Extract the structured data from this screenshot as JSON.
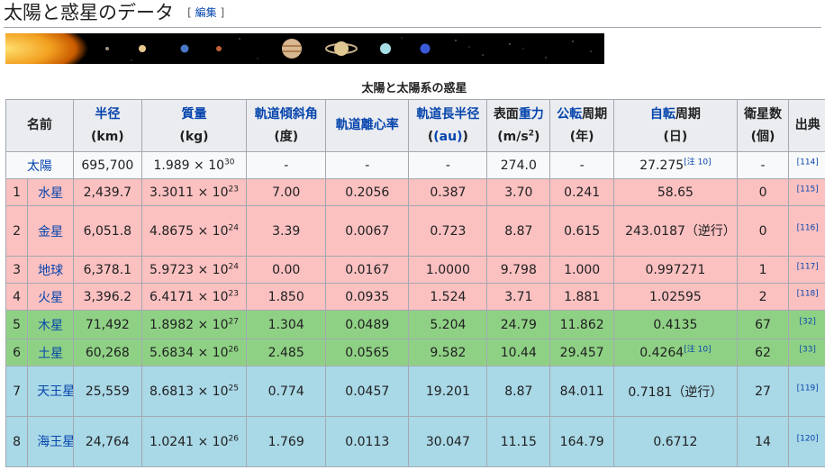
{
  "heading": {
    "title": "太陽と惑星のデータ",
    "edit_open": "[",
    "edit_label": "編集",
    "edit_close": "]"
  },
  "caption": "太陽と太陽系の惑星",
  "headers": {
    "name": "名前",
    "radius": [
      "半径",
      "(km)"
    ],
    "mass": [
      "質量",
      "(kg)"
    ],
    "incl": [
      "軌道傾斜角",
      "(度)"
    ],
    "ecc": "軌道離心率",
    "sma": [
      "軌道長半径",
      "(au)"
    ],
    "grav_a": "表面",
    "grav_b": "重力",
    "grav_unit_a": "(m/s",
    "grav_unit_sup": "2",
    "grav_unit_b": ")",
    "orbit_a": "公転",
    "orbit_b": "周期",
    "orbit_unit": "(年)",
    "rot_a": "自転",
    "rot_b": "周期",
    "rot_unit": "(日)",
    "moons": [
      "衛星数",
      "(個)"
    ],
    "source": "出典"
  },
  "rows": [
    {
      "idx": "",
      "name": "太陽",
      "radius": "695,700",
      "mass": "1.989 × 10",
      "mass_exp": "30",
      "incl": "-",
      "ecc": "-",
      "sma": "-",
      "gravity": "274.0",
      "orbit": "-",
      "rotation": "27.275",
      "rot_note": "[注 10]",
      "moons": "-",
      "ref": "[114]"
    },
    {
      "idx": "1",
      "name": "水星",
      "radius": "2,439.7",
      "mass": "3.3011 × 10",
      "mass_exp": "23",
      "incl": "7.00",
      "ecc": "0.2056",
      "sma": "0.387",
      "gravity": "3.70",
      "orbit": "0.241",
      "rotation": "58.65",
      "rot_note": "",
      "moons": "0",
      "ref": "[115]"
    },
    {
      "idx": "2",
      "name": "金星",
      "radius": "6,051.8",
      "mass": "4.8675 × 10",
      "mass_exp": "24",
      "incl": "3.39",
      "ecc": "0.0067",
      "sma": "0.723",
      "gravity": "8.87",
      "orbit": "0.615",
      "rotation": "243.0187（逆行）",
      "rot_note": "",
      "moons": "0",
      "ref": "[116]"
    },
    {
      "idx": "3",
      "name": "地球",
      "radius": "6,378.1",
      "mass": "5.9723 × 10",
      "mass_exp": "24",
      "incl": "0.00",
      "ecc": "0.0167",
      "sma": "1.0000",
      "gravity": "9.798",
      "orbit": "1.000",
      "rotation": "0.997271",
      "rot_note": "",
      "moons": "1",
      "ref": "[117]"
    },
    {
      "idx": "4",
      "name": "火星",
      "radius": "3,396.2",
      "mass": "6.4171 × 10",
      "mass_exp": "23",
      "incl": "1.850",
      "ecc": "0.0935",
      "sma": "1.524",
      "gravity": "3.71",
      "orbit": "1.881",
      "rotation": "1.02595",
      "rot_note": "",
      "moons": "2",
      "ref": "[118]"
    },
    {
      "idx": "5",
      "name": "木星",
      "radius": "71,492",
      "mass": "1.8982 × 10",
      "mass_exp": "27",
      "incl": "1.304",
      "ecc": "0.0489",
      "sma": "5.204",
      "gravity": "24.79",
      "orbit": "11.862",
      "rotation": "0.4135",
      "rot_note": "",
      "moons": "67",
      "ref": "[32]"
    },
    {
      "idx": "6",
      "name": "土星",
      "radius": "60,268",
      "mass": "5.6834 × 10",
      "mass_exp": "26",
      "incl": "2.485",
      "ecc": "0.0565",
      "sma": "9.582",
      "gravity": "10.44",
      "orbit": "29.457",
      "rotation": "0.4264",
      "rot_note": "[注 10]",
      "moons": "62",
      "ref": "[33]"
    },
    {
      "idx": "7",
      "name": "天王星",
      "radius": "25,559",
      "mass": "8.6813 × 10",
      "mass_exp": "25",
      "incl": "0.774",
      "ecc": "0.0457",
      "sma": "19.201",
      "gravity": "8.87",
      "orbit": "84.011",
      "rotation": "0.7181（逆行）",
      "rot_note": "",
      "moons": "27",
      "ref": "[119]"
    },
    {
      "idx": "8",
      "name": "海王星",
      "radius": "24,764",
      "mass": "1.0241 × 10",
      "mass_exp": "26",
      "incl": "1.769",
      "ecc": "0.0113",
      "sma": "30.047",
      "gravity": "11.15",
      "orbit": "164.79",
      "rotation": "0.6712",
      "rot_note": "",
      "moons": "14",
      "ref": "[120]"
    }
  ],
  "colors": {
    "sun": "#f8f9fa",
    "terrestrial": "#fbc0c0",
    "gas_giant": "#8fd184",
    "ice_giant": "#a9d8e6",
    "link": "#0645ad"
  }
}
